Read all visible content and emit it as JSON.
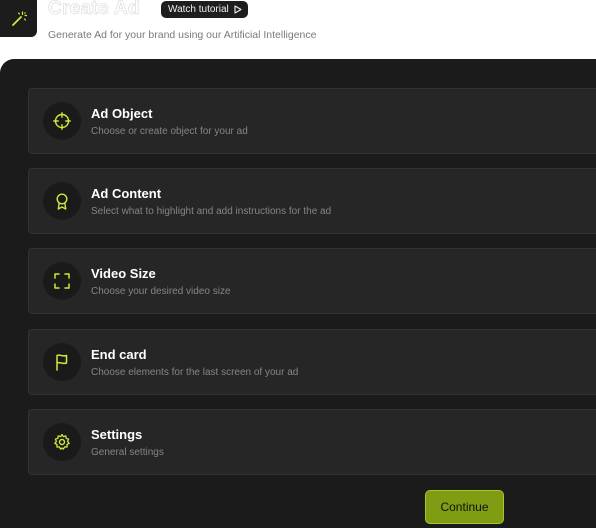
{
  "header": {
    "title": "Create Ad",
    "tutorial_label": "Watch tutorial",
    "subtitle": "Generate Ad for your brand using our Artificial Intelligence"
  },
  "cards": [
    {
      "title": "Ad Object",
      "description": "Choose or create object for your ad",
      "icon": "target-icon"
    },
    {
      "title": "Ad Content",
      "description": "Select what to highlight and add instructions for the ad",
      "icon": "award-ribbon-icon"
    },
    {
      "title": "Video Size",
      "description": "Choose your desired video size",
      "icon": "frame-corners-icon"
    },
    {
      "title": "End card",
      "description": "Choose elements for the last screen of your ad",
      "icon": "flag-icon"
    },
    {
      "title": "Settings",
      "description": "General settings",
      "icon": "gear-icon"
    }
  ],
  "footer": {
    "continue_label": "Continue"
  },
  "colors": {
    "accent": "#d4e83a",
    "button": "#7f9c12",
    "panel": "#1b1b1b",
    "card": "#262626"
  }
}
